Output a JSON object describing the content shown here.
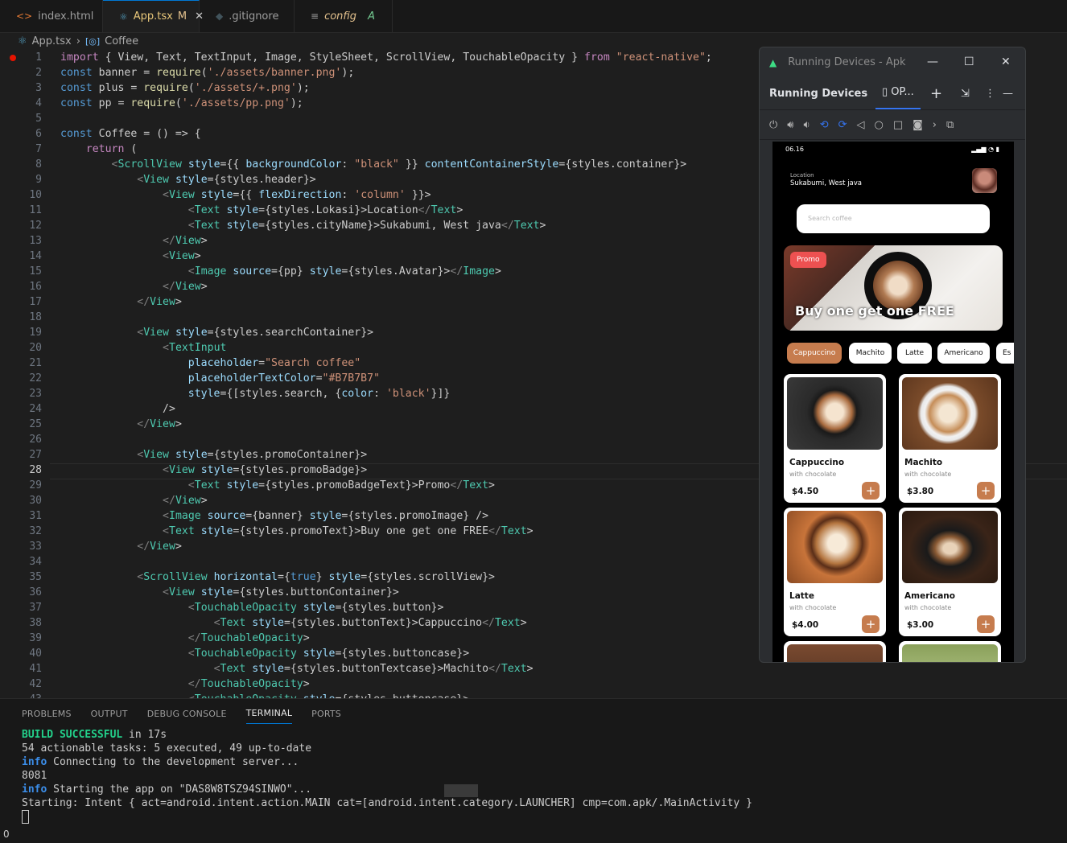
{
  "tabs": [
    {
      "label": "index.html",
      "icon": "html-icon"
    },
    {
      "label": "App.tsx",
      "status": "M",
      "icon": "react-icon"
    },
    {
      "label": ".gitignore",
      "icon": "git-icon"
    },
    {
      "label": "config",
      "status": "A",
      "icon": "settings-file-icon"
    }
  ],
  "breadcrumb": {
    "file": "App.tsx",
    "symbol": "Coffee"
  },
  "editor": {
    "current_line": 28,
    "lines": [
      "import { View, Text, TextInput, Image, StyleSheet, ScrollView, TouchableOpacity } from \"react-native\";",
      "const banner = require('./assets/banner.png');",
      "const plus = require('./assets/+.png');",
      "const pp = require('./assets/pp.png');",
      "",
      "const Coffee = () => {",
      "    return (",
      "        <ScrollView style={{ backgroundColor: \"black\" }} contentContainerStyle={styles.container}>",
      "            <View style={styles.header}>",
      "                <View style={{ flexDirection: 'column' }}>",
      "                    <Text style={styles.Lokasi}>Location</Text>",
      "                    <Text style={styles.cityName}>Sukabumi, West java</Text>",
      "                </View>",
      "                <View>",
      "                    <Image source={pp} style={styles.Avatar}></Image>",
      "                </View>",
      "            </View>",
      "",
      "            <View style={styles.searchContainer}>",
      "                <TextInput",
      "                    placeholder=\"Search coffee\"",
      "                    placeholderTextColor=\"#B7B7B7\"",
      "                    style={[styles.search, {color: 'black'}]}",
      "                />",
      "            </View>",
      "",
      "            <View style={styles.promoContainer}>",
      "                <View style={styles.promoBadge}>",
      "                    <Text style={styles.promoBadgeText}>Promo</Text>",
      "                </View>",
      "                <Image source={banner} style={styles.promoImage} />",
      "                <Text style={styles.promoText}>Buy one get one FREE</Text>",
      "            </View>",
      "",
      "            <ScrollView horizontal={true} style={styles.scrollView}>",
      "                <View style={styles.buttonContainer}>",
      "                    <TouchableOpacity style={styles.button}>",
      "                        <Text style={styles.buttonText}>Cappuccino</Text>",
      "                    </TouchableOpacity>",
      "                    <TouchableOpacity style={styles.buttoncase}>",
      "                        <Text style={styles.buttonTextcase}>Machito</Text>",
      "                    </TouchableOpacity>",
      "                    <TouchableOpacity style={styles.buttoncase}>"
    ]
  },
  "panel": {
    "tabs": [
      "PROBLEMS",
      "OUTPUT",
      "DEBUG CONSOLE",
      "TERMINAL",
      "PORTS"
    ],
    "active_tab": "TERMINAL",
    "terminal": {
      "build_status": "BUILD SUCCESSFUL",
      "build_time": " in 17s",
      "tasks": "54 actionable tasks: 5 executed, 49 up-to-date",
      "info_label": "info",
      "info1": " Connecting to the development server...",
      "port": "8081",
      "info2": " Starting the app on \"DAS8W8TSZ94SINWO\"...",
      "intent": "Starting: Intent { act=android.intent.action.MAIN cat=[android.intent.category.LAUNCHER] cmp=com.apk/.MainActivity }"
    }
  },
  "statusbar": {
    "left": "0"
  },
  "emulator": {
    "window_title": "Running Devices - Apk",
    "panel_title": "Running Devices",
    "device_tab": "OP...",
    "phone": {
      "clock": "06.16",
      "location_label": "Location",
      "city": "Sukabumi, West java",
      "search_placeholder": "Search coffee",
      "promo_badge": "Promo",
      "promo_text": "Buy one get one FREE",
      "chips": [
        "Cappuccino",
        "Machito",
        "Latte",
        "Americano",
        "Es"
      ],
      "products": [
        {
          "name": "Cappuccino",
          "desc": "with chocolate",
          "price": "$4.50"
        },
        {
          "name": "Machito",
          "desc": "with chocolate",
          "price": "$3.80"
        },
        {
          "name": "Latte",
          "desc": "with chocolate",
          "price": "$4.00"
        },
        {
          "name": "Americano",
          "desc": "with chocolate",
          "price": "$3.00"
        }
      ],
      "add_symbol": "+"
    }
  }
}
